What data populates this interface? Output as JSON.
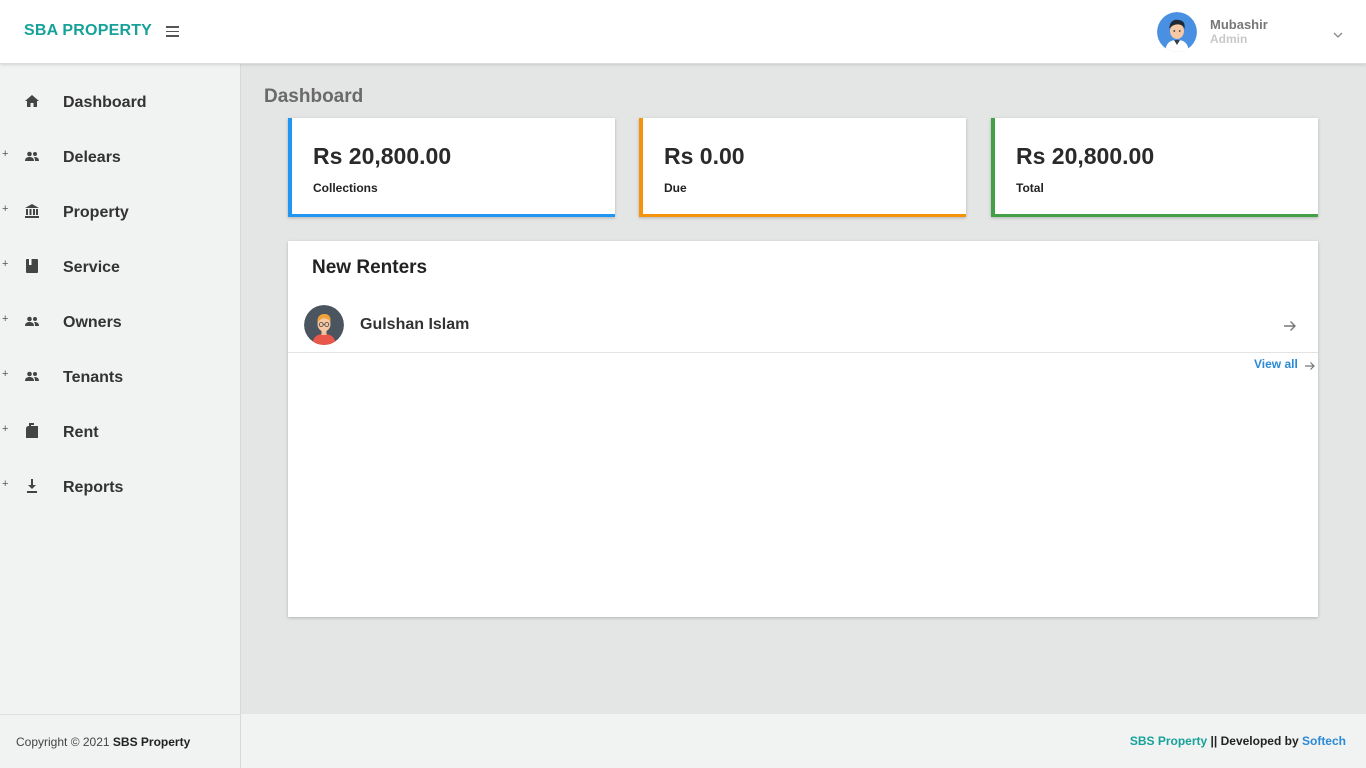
{
  "header": {
    "brand": "SBA PROPERTY",
    "menu_icon": "hamburger-icon",
    "user": {
      "name": "Mubashir",
      "role": "Admin",
      "avatar": "user-avatar",
      "dropdown_icon": "chevron-down-icon"
    }
  },
  "sidebar": {
    "items": [
      {
        "label": "Dashboard",
        "icon": "home-icon",
        "expandable": false
      },
      {
        "label": "Delears",
        "icon": "people-icon",
        "expandable": true
      },
      {
        "label": "Property",
        "icon": "bank-icon",
        "expandable": true
      },
      {
        "label": "Service",
        "icon": "book-icon",
        "expandable": true
      },
      {
        "label": "Owners",
        "icon": "people-icon",
        "expandable": true
      },
      {
        "label": "Tenants",
        "icon": "people-icon",
        "expandable": true
      },
      {
        "label": "Rent",
        "icon": "mailbox-icon",
        "expandable": true
      },
      {
        "label": "Reports",
        "icon": "download-icon",
        "expandable": true
      }
    ],
    "expand_glyph": "+",
    "footer": {
      "copyright_prefix": "Copyright © 2021",
      "company": "SBS Property"
    }
  },
  "main": {
    "page_title": "Dashboard",
    "stats": [
      {
        "value": "Rs 20,800.00",
        "label": "Collections",
        "color": "#2196f3"
      },
      {
        "value": "Rs 0.00",
        "label": "Due",
        "color": "#f5930b"
      },
      {
        "value": "Rs 20,800.00",
        "label": "Total",
        "color": "#43a047"
      }
    ],
    "new_renters": {
      "title": "New Renters",
      "items": [
        {
          "name": "Gulshan Islam",
          "icon": "arrow-right-icon"
        }
      ],
      "view_all_label": "View all"
    }
  },
  "footer": {
    "brand": "SBS Property",
    "separator": "||",
    "developed_by": "Developed by",
    "developer": "Softech"
  },
  "colors": {
    "brand_teal": "#16a299",
    "link_blue": "#2a8ad6"
  }
}
